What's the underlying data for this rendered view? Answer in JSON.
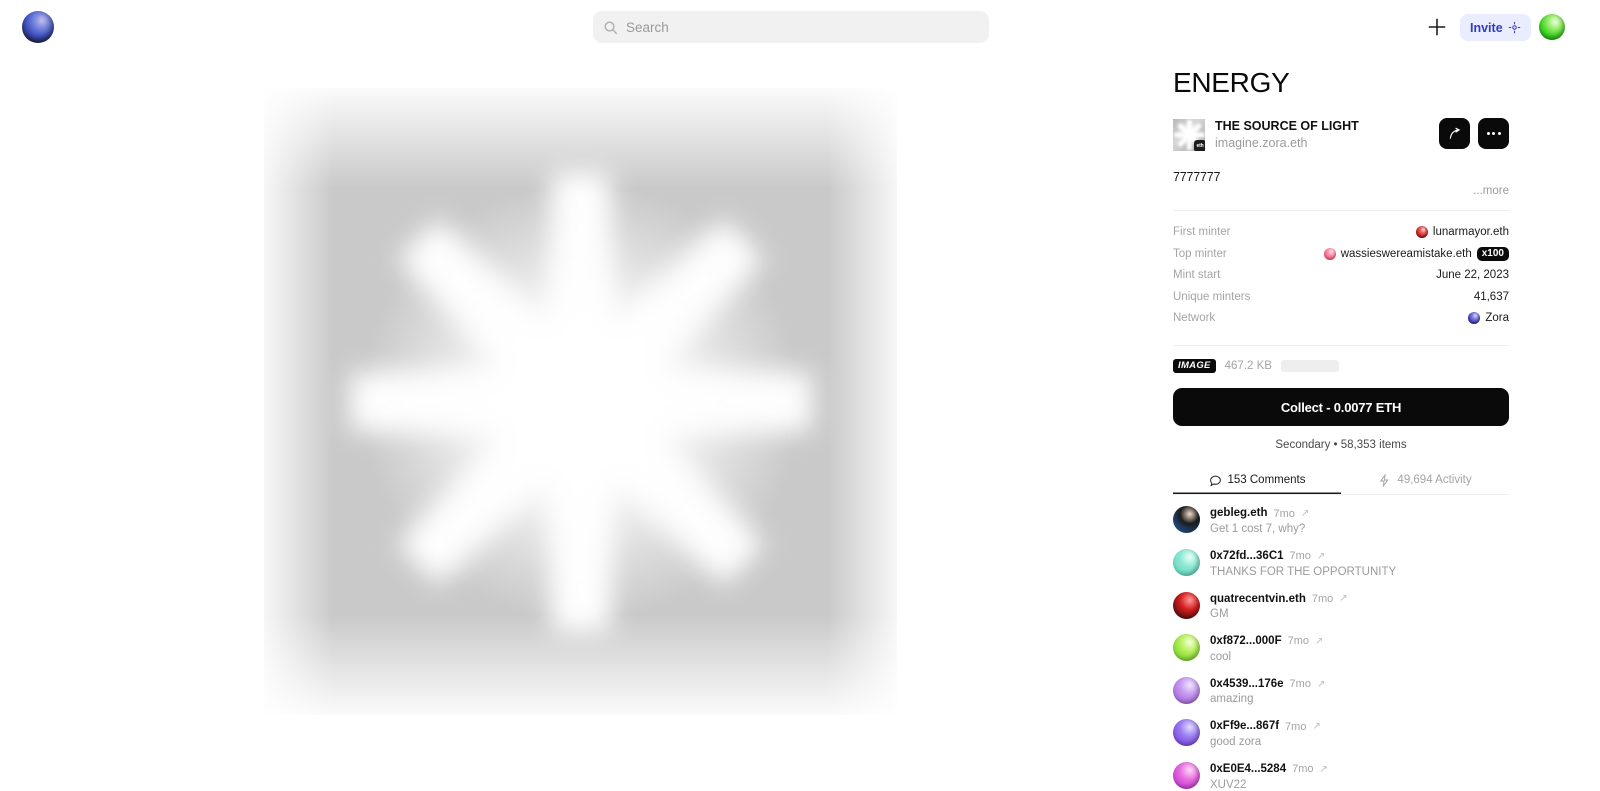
{
  "topbar": {
    "logo_name": "zora-orb-logo",
    "search": {
      "placeholder": "Search",
      "value": "",
      "icon": "search-icon"
    },
    "plus_icon": "plus-icon",
    "invite_label": "Invite",
    "invite_icon": "sparkle-node-icon",
    "avatar_name": "user-avatar-orb"
  },
  "artwork": {
    "alt": "grey and white radial starburst light rays",
    "rays": [
      0,
      45,
      90,
      135,
      180,
      225,
      270,
      315
    ]
  },
  "panel": {
    "title": "ENERGY",
    "collection_name": "THE SOURCE OF LIGHT",
    "creator_handle": "imagine.zora.eth",
    "chain_badge": "eth",
    "share_icon": "share-arrow-icon",
    "more_icon": "more-dots-icon",
    "description": "7777777",
    "more_link": "...more",
    "meta": [
      {
        "key": "First minter",
        "value": "lunarmayor.eth",
        "orb": "orb-red",
        "badge": ""
      },
      {
        "key": "Top minter",
        "value": "wassieswereamistake.eth",
        "orb": "orb-pink",
        "badge": "x100"
      },
      {
        "key": "Mint start",
        "value": "June 22, 2023",
        "orb": "",
        "badge": ""
      },
      {
        "key": "Unique minters",
        "value": "41,637",
        "orb": "",
        "badge": ""
      },
      {
        "key": "Network",
        "value": "Zora",
        "orb": "orb-blue",
        "badge": ""
      }
    ],
    "file": {
      "type_badge": "IMAGE",
      "size": "467.2 KB"
    },
    "collect_button": "Collect - 0.0077 ETH",
    "secondary": "Secondary • 58,353 items",
    "tabs": [
      {
        "label": "153 Comments",
        "icon": "comment-icon",
        "active": true
      },
      {
        "label": "49,694 Activity",
        "icon": "lightning-icon",
        "active": false
      }
    ]
  },
  "comments": [
    {
      "user": "gebleg.eth",
      "time": "7mo",
      "text": "Get 1 cost 7, why?",
      "avatar_colors": [
        "#f2d9c9",
        "#1b1b1b",
        "#2a6fd4"
      ]
    },
    {
      "user": "0x72fd...36C1",
      "time": "7mo",
      "text": "THANKS FOR THE OPPORTUNITY",
      "avatar_colors": [
        "#eafff8",
        "#8fe8d3",
        "#4fd0b6"
      ]
    },
    {
      "user": "quatrecentvin.eth",
      "time": "7mo",
      "text": "GM",
      "avatar_colors": [
        "#ff9a9a",
        "#d41f1f",
        "#1b0404"
      ]
    },
    {
      "user": "0xf872...000F",
      "time": "7mo",
      "text": "cool",
      "avatar_colors": [
        "#f4ffd6",
        "#b4f05a",
        "#5fc118"
      ]
    },
    {
      "user": "0x4539...176e",
      "time": "7mo",
      "text": "amazing",
      "avatar_colors": [
        "#f0e4ff",
        "#c69af0",
        "#9a4ed8"
      ]
    },
    {
      "user": "0xFf9e...867f",
      "time": "7mo",
      "text": "good zora",
      "avatar_colors": [
        "#e4dcff",
        "#9b7ef0",
        "#6a2bd8"
      ]
    },
    {
      "user": "0xE0E4...5284",
      "time": "7mo",
      "text": "XUV22",
      "avatar_colors": [
        "#ffd9f8",
        "#e86fe0",
        "#b620c8"
      ]
    }
  ],
  "external_link_glyph": "↗"
}
